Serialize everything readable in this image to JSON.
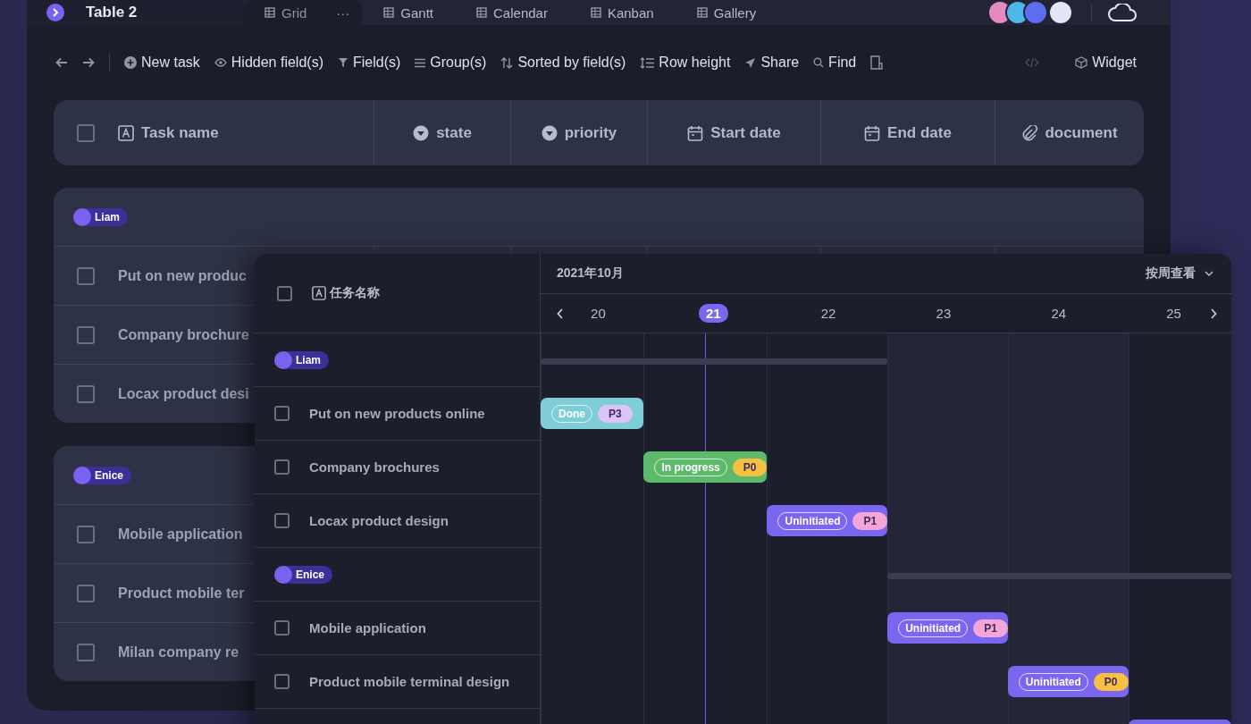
{
  "tabbar": {
    "table_name": "Table 2",
    "more": "···",
    "views": [
      {
        "label": "Grid",
        "selected": true
      },
      {
        "label": "Gantt",
        "selected": false
      },
      {
        "label": "Calendar",
        "selected": false
      },
      {
        "label": "Kanban",
        "selected": false
      },
      {
        "label": "Gallery",
        "selected": false
      }
    ]
  },
  "toolbar": [
    {
      "kind": "undo"
    },
    {
      "kind": "redo"
    },
    {
      "kind": "add",
      "label": "New task"
    },
    {
      "kind": "eye",
      "label": "Hidden field(s)"
    },
    {
      "kind": "filter",
      "label": "Field(s)"
    },
    {
      "kind": "group",
      "label": "Group(s)"
    },
    {
      "kind": "sort",
      "label": "Sorted by field(s)"
    },
    {
      "kind": "height",
      "label": "Row height"
    },
    {
      "kind": "share",
      "label": "Share"
    },
    {
      "kind": "find",
      "label": "Find"
    },
    {
      "kind": "form"
    },
    {
      "kind": "code"
    },
    {
      "kind": "widget",
      "label": "Widget"
    }
  ],
  "grid": {
    "select_all": {
      "checked": false
    },
    "columns": [
      {
        "label": "Task name",
        "kind": "text"
      },
      {
        "label": "state",
        "kind": "select"
      },
      {
        "label": "priority",
        "kind": "select"
      },
      {
        "label": "Start date",
        "kind": "date"
      },
      {
        "label": "End date",
        "kind": "date"
      },
      {
        "label": "document",
        "kind": "attachment"
      }
    ],
    "groups": [
      {
        "name": "Liam",
        "color": "#7b61f0",
        "rows": [
          {
            "name": "Put on new produc",
            "checked": false
          },
          {
            "name": "Company brochure",
            "checked": false
          },
          {
            "name": "Locax product desi",
            "checked": false
          }
        ]
      },
      {
        "name": "Enice",
        "color": "#7b61f0",
        "rows": [
          {
            "name": "Mobile application",
            "checked": false
          },
          {
            "name": "Product mobile ter",
            "checked": false
          },
          {
            "name": "Milan  company re",
            "checked": false
          }
        ]
      }
    ]
  },
  "gantt": {
    "select_all": {
      "checked": false
    },
    "column_header": "任务名称",
    "month": "2021年10月",
    "view_mode": "按周查看",
    "days": [
      {
        "label": "20",
        "selected": false,
        "shaded": false
      },
      {
        "label": "21",
        "selected": true,
        "shaded": false
      },
      {
        "label": "22",
        "selected": false,
        "shaded": false
      },
      {
        "label": "23",
        "selected": false,
        "shaded": true
      },
      {
        "label": "24",
        "selected": false,
        "shaded": true
      },
      {
        "label": "25",
        "selected": false,
        "shaded": false
      }
    ],
    "groups": [
      {
        "name": "Liam",
        "color": "#7b61f0",
        "tasks": [
          {
            "name": "Put on new products online",
            "checked": false,
            "bar": {
              "status": "Done",
              "priority": {
                "label": "P3",
                "color": "#dcc4f6"
              },
              "color": "#7fcdd7"
            }
          },
          {
            "name": "Company brochures",
            "checked": false,
            "bar": {
              "status": "In progress",
              "priority": {
                "label": "P0",
                "color": "#f7c043"
              },
              "color": "#5cba6a"
            }
          },
          {
            "name": "Locax product design",
            "checked": false,
            "bar": {
              "status": "Uninitiated",
              "priority": {
                "label": "P1",
                "color": "#f5a6d6"
              },
              "color": "#7b66ef"
            }
          }
        ]
      },
      {
        "name": "Enice",
        "color": "#7b61f0",
        "tasks": [
          {
            "name": "Mobile application",
            "checked": false,
            "bar": {
              "status": "Uninitiated",
              "priority": {
                "label": "P1",
                "color": "#f5a6d6"
              },
              "color": "#7b66ef"
            }
          },
          {
            "name": "Product mobile terminal design",
            "checked": false,
            "bar": {
              "status": "Uninitiated",
              "priority": {
                "label": "P0",
                "color": "#f7c043"
              },
              "color": "#7b66ef"
            }
          },
          {
            "bar": {
              "color": "#7b66ef"
            }
          }
        ]
      }
    ]
  }
}
